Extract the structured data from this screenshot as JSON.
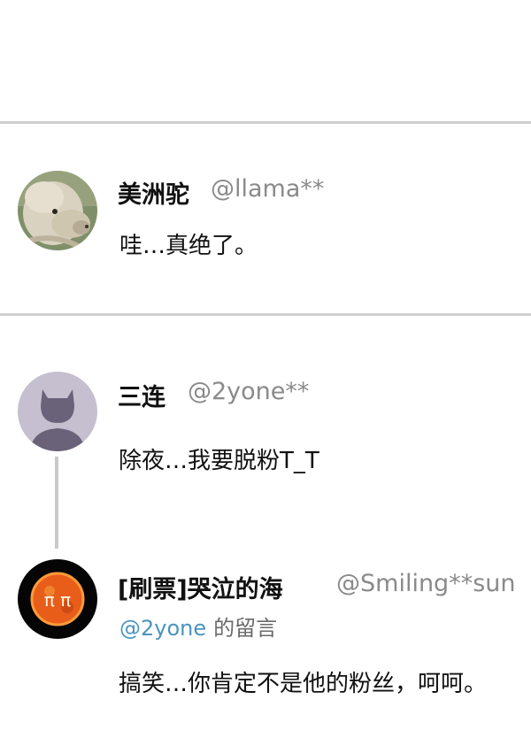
{
  "comments": [
    {
      "name": "美洲驼",
      "handle": "@llama**",
      "text": "哇…真绝了。",
      "avatar_icon": "alpaca-photo-avatar"
    },
    {
      "name": "三连",
      "handle": "@2yone**",
      "text": "除夜…我要脱粉T_T",
      "avatar_icon": "default-cat-user-avatar"
    },
    {
      "name": "[刷票]哭泣的海",
      "handle": "@Smiling**sun",
      "reply_to": "@2yone",
      "reply_suffix": "的留言",
      "text": "搞笑…你肯定不是他的粉丝，呵呵。",
      "avatar_icon": "crying-sun-avatar"
    }
  ],
  "colors": {
    "divider": "#cfcfcf",
    "handle": "#8a8a8a",
    "reply_link": "#4a94be",
    "thread_line": "#c9c9c9"
  }
}
